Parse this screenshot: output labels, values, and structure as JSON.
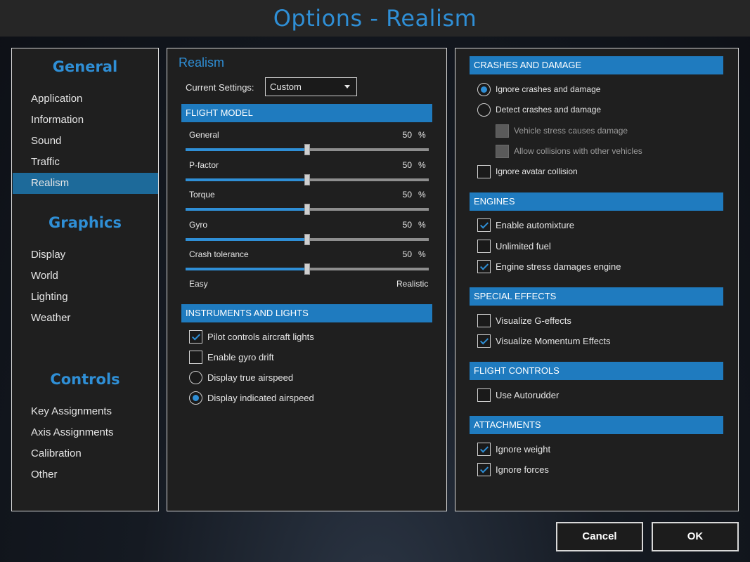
{
  "window": {
    "title": "Options - Realism"
  },
  "nav": {
    "sections": [
      {
        "heading": "General",
        "items": [
          "Application",
          "Information",
          "Sound",
          "Traffic",
          "Realism"
        ]
      },
      {
        "heading": "Graphics",
        "items": [
          "Display",
          "World",
          "Lighting",
          "Weather"
        ]
      },
      {
        "heading": "Controls",
        "items": [
          "Key Assignments",
          "Axis Assignments",
          "Calibration",
          "Other"
        ]
      }
    ],
    "active_item": "Realism"
  },
  "middle": {
    "title": "Realism",
    "current_settings_label": "Current Settings:",
    "current_settings_value": "Custom",
    "flight_model": {
      "header": "FLIGHT MODEL",
      "sliders": [
        {
          "label": "General",
          "value": "50",
          "unit": "%",
          "fraction": 0.5
        },
        {
          "label": "P-factor",
          "value": "50",
          "unit": "%",
          "fraction": 0.5
        },
        {
          "label": "Torque",
          "value": "50",
          "unit": "%",
          "fraction": 0.5
        },
        {
          "label": "Gyro",
          "value": "50",
          "unit": "%",
          "fraction": 0.5
        },
        {
          "label": "Crash tolerance",
          "value": "50",
          "unit": "%",
          "fraction": 0.5
        }
      ],
      "scale_min": "Easy",
      "scale_max": "Realistic"
    },
    "instruments": {
      "header": "INSTRUMENTS AND LIGHTS",
      "options": [
        {
          "label": "Pilot controls aircraft lights",
          "type": "checkbox",
          "checked": true
        },
        {
          "label": "Enable gyro drift",
          "type": "checkbox",
          "checked": false
        },
        {
          "label": "Display true airspeed",
          "type": "radio",
          "checked": false
        },
        {
          "label": "Display indicated airspeed",
          "type": "radio",
          "checked": true
        }
      ]
    }
  },
  "right": {
    "crashes": {
      "header": "CRASHES AND DAMAGE",
      "options": [
        {
          "label": "Ignore crashes and damage",
          "type": "radio",
          "checked": true
        },
        {
          "label": "Detect crashes and damage",
          "type": "radio",
          "checked": false
        },
        {
          "label": "Vehicle stress causes damage",
          "type": "checkbox",
          "checked": false,
          "disabled": true
        },
        {
          "label": "Allow collisions with other vehicles",
          "type": "checkbox",
          "checked": false,
          "disabled": true
        },
        {
          "label": "Ignore avatar collision",
          "type": "checkbox",
          "checked": false
        }
      ]
    },
    "engines": {
      "header": "ENGINES",
      "options": [
        {
          "label": "Enable automixture",
          "type": "checkbox",
          "checked": true
        },
        {
          "label": "Unlimited fuel",
          "type": "checkbox",
          "checked": false
        },
        {
          "label": "Engine stress damages engine",
          "type": "checkbox",
          "checked": true
        }
      ]
    },
    "special_effects": {
      "header": "SPECIAL EFFECTS",
      "options": [
        {
          "label": "Visualize G-effects",
          "type": "checkbox",
          "checked": false
        },
        {
          "label": "Visualize Momentum Effects",
          "type": "checkbox",
          "checked": true
        }
      ]
    },
    "flight_controls": {
      "header": "FLIGHT CONTROLS",
      "options": [
        {
          "label": "Use Autorudder",
          "type": "checkbox",
          "checked": false
        }
      ]
    },
    "attachments": {
      "header": "ATTACHMENTS",
      "options": [
        {
          "label": "Ignore weight",
          "type": "checkbox",
          "checked": true
        },
        {
          "label": "Ignore forces",
          "type": "checkbox",
          "checked": true
        }
      ]
    }
  },
  "buttons": {
    "cancel": "Cancel",
    "ok": "OK"
  },
  "colors": {
    "accent": "#2f8fd6",
    "header_bg": "#1f7bbf",
    "active_nav": "#1d6a9a",
    "panel_bg": "#1f1f1f"
  }
}
